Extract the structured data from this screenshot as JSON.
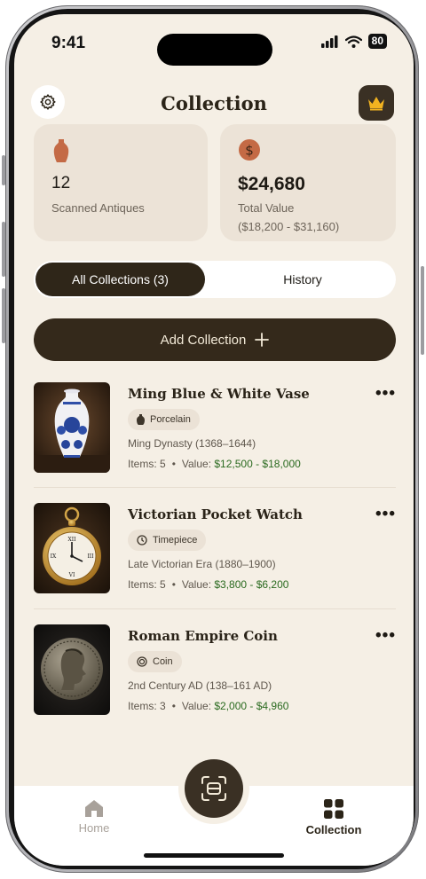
{
  "status": {
    "time": "9:41",
    "battery": "80"
  },
  "header": {
    "title": "Collection",
    "settings_icon": "gear-icon",
    "premium_icon": "crown-icon"
  },
  "stats": [
    {
      "value": "12",
      "label": "Scanned Antiques",
      "icon": "vase-icon"
    },
    {
      "value": "$24,680",
      "label": "Total Value",
      "sub": "($18,200 - $31,160)",
      "icon": "dollar-coin-icon"
    }
  ],
  "tabs": [
    {
      "label": "All Collections (3)",
      "active": true
    },
    {
      "label": "History",
      "active": false
    }
  ],
  "add_button": {
    "label": "Add Collection",
    "icon": "plus-icon"
  },
  "collections": [
    {
      "name": "Ming Blue & White Vase",
      "tag": "Porcelain",
      "era": "Ming Dynasty (1368–1644)",
      "items": "Items: 5",
      "value_label": "Value:",
      "value": "$12,500 - $18,000"
    },
    {
      "name": "Victorian Pocket Watch",
      "tag": "Timepiece",
      "era": "Late Victorian Era (1880–1900)",
      "items": "Items: 5",
      "value_label": "Value:",
      "value": "$3,800 - $6,200"
    },
    {
      "name": "Roman Empire Coin",
      "tag": "Coin",
      "era": "2nd Century AD (138–161 AD)",
      "items": "Items: 3",
      "value_label": "Value:",
      "value": "$2,000 - $4,960"
    }
  ],
  "nav": {
    "home": "Home",
    "collection": "Collection",
    "scan_icon": "scan-icon"
  },
  "colors": {
    "background": "#f5efe5",
    "accent_dark": "#34291b",
    "money_green": "#2a6a1f",
    "card": "#ece3d7"
  }
}
